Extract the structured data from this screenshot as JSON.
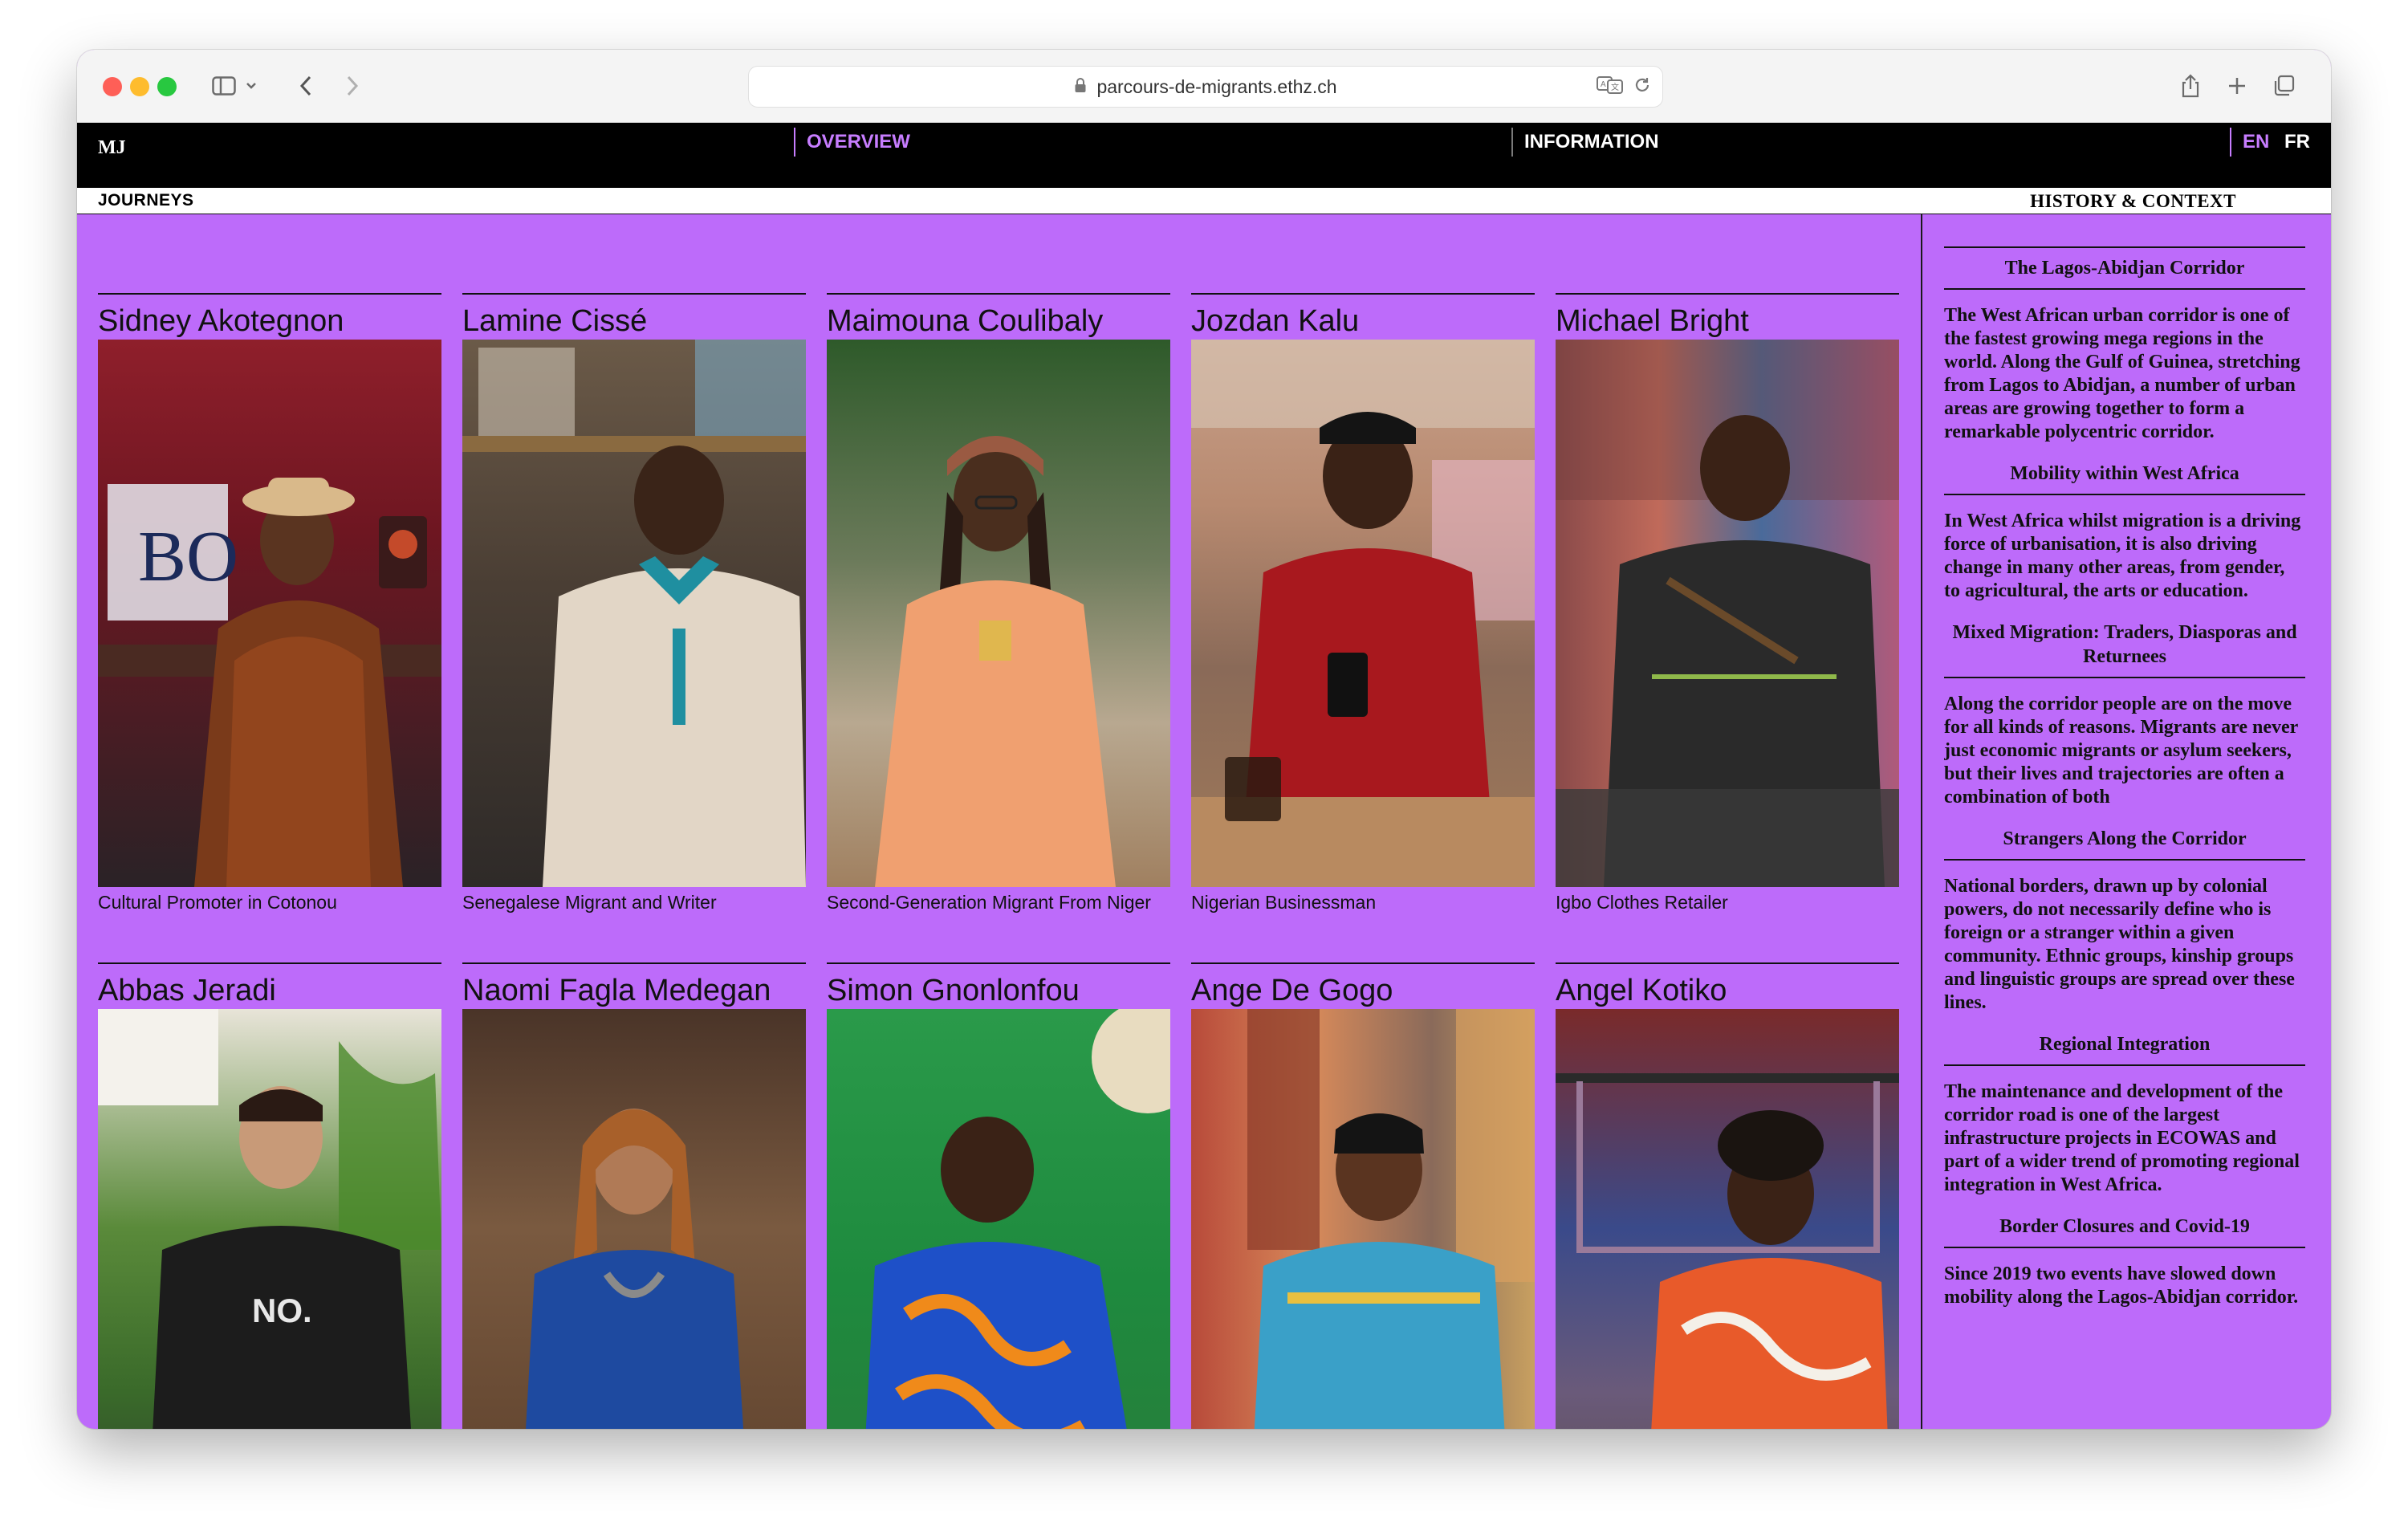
{
  "browser": {
    "url": "parcours-de-migrants.ethz.ch",
    "icons": [
      "sidebar-icon",
      "chevron-down-icon",
      "back-icon",
      "forward-icon",
      "lock-icon",
      "translate-icon",
      "reload-icon",
      "share-icon",
      "new-tab-icon",
      "tabs-icon"
    ]
  },
  "nav": {
    "logo": "MJ",
    "overview": "OVERVIEW",
    "information": "INFORMATION",
    "lang_en": "EN",
    "lang_fr": "FR"
  },
  "subheader": {
    "left": "JOURNEYS",
    "right": "HISTORY & CONTEXT"
  },
  "colors": {
    "accent": "#bd6bfa",
    "nav_bg": "#000000",
    "active_link": "#c77dff"
  },
  "journeys": [
    {
      "name": "Sidney Akotegnon",
      "caption": "Cultural Promoter in Cotonou"
    },
    {
      "name": "Lamine Cissé",
      "caption": "Senegalese Migrant and Writer"
    },
    {
      "name": "Maimouna Coulibaly",
      "caption": "Second-Generation Migrant From Niger"
    },
    {
      "name": "Jozdan Kalu",
      "caption": "Nigerian Businessman"
    },
    {
      "name": "Michael Bright",
      "caption": "Igbo Clothes Retailer"
    },
    {
      "name": "Abbas Jeradi",
      "caption": ""
    },
    {
      "name": "Naomi Fagla Medegan",
      "caption": ""
    },
    {
      "name": "Simon Gnonlonfou",
      "caption": ""
    },
    {
      "name": "Ange De Gogo",
      "caption": ""
    },
    {
      "name": "Angel Kotiko",
      "caption": ""
    }
  ],
  "sidebar": {
    "sections": [
      {
        "title": "The Lagos-Abidjan Corridor",
        "body": "The West African urban corridor is one of the fastest growing mega regions in the world. Along the Gulf of Guinea, stretching from Lagos to Abidjan, a number of urban areas are growing together to form a remarkable polycentric corridor."
      },
      {
        "title": "Mobility within West Africa",
        "body": "In West Africa whilst migration is a driving force of urbanisation, it is also driving change in many other areas, from gender, to agricultural, the arts or education."
      },
      {
        "title": "Mixed Migration: Traders, Diasporas and Returnees",
        "body": "Along the corridor people are on the move for all kinds of reasons. Migrants are never just economic migrants or asylum seekers, but their lives and trajectories are often a combination of both"
      },
      {
        "title": "Strangers Along the Corridor",
        "body": "National borders, drawn up by colonial powers, do not necessarily define who is foreign or a stranger within a given community. Ethnic groups, kinship groups and linguistic groups are spread over these lines."
      },
      {
        "title": "Regional Integration",
        "body": "The maintenance and development of the corridor road is one of the largest infrastructure projects in ECOWAS and part of a wider trend of promoting regional integration in West Africa."
      },
      {
        "title": "Border Closures and Covid-19",
        "body": "Since 2019 two events have slowed down mobility along the Lagos-Abidjan corridor."
      }
    ]
  }
}
